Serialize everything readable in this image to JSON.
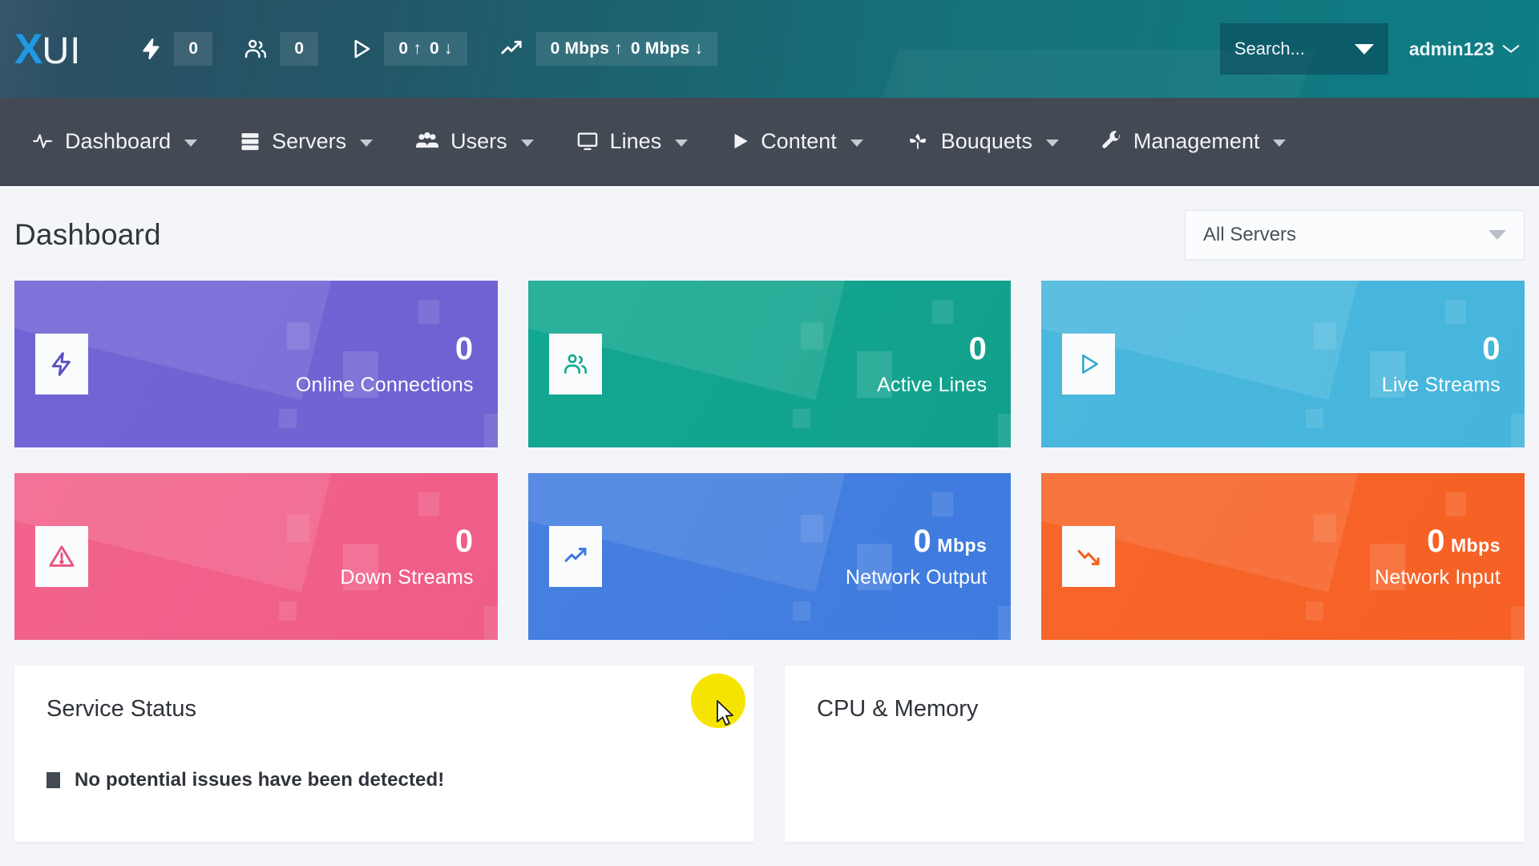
{
  "topbar": {
    "logo": {
      "x": "X",
      "ui": "UI"
    },
    "stats": [
      {
        "icon": "bolt-icon",
        "name": "connections",
        "parts": [
          "0"
        ]
      },
      {
        "icon": "users-icon",
        "name": "users",
        "parts": [
          "0"
        ]
      },
      {
        "icon": "play-icon",
        "name": "streams",
        "parts": [
          "0 ↑",
          "0 ↓"
        ]
      },
      {
        "icon": "trending-up-icon",
        "name": "network",
        "parts": [
          "0 Mbps ↑",
          "0 Mbps ↓"
        ]
      }
    ],
    "search": {
      "placeholder": "Search...",
      "value": "",
      "caret_icon": "caret-down-icon"
    },
    "user": {
      "label": "admin123",
      "chevron_icon": "chevron-down-icon"
    }
  },
  "nav": {
    "items": [
      {
        "label": "Dashboard",
        "icon": "pulse-icon"
      },
      {
        "label": "Servers",
        "icon": "server-icon"
      },
      {
        "label": "Users",
        "icon": "users-group-icon"
      },
      {
        "label": "Lines",
        "icon": "monitor-icon"
      },
      {
        "label": "Content",
        "icon": "play-filled-icon"
      },
      {
        "label": "Bouquets",
        "icon": "leaf-icon"
      },
      {
        "label": "Management",
        "icon": "wrench-icon"
      }
    ]
  },
  "page": {
    "title": "Dashboard",
    "server_filter": {
      "value": "All Servers",
      "caret_icon": "caret-down-icon"
    }
  },
  "cards": [
    {
      "name": "online-connections",
      "icon": "bolt-icon",
      "value": "0",
      "unit": "",
      "label": "Online Connections",
      "color1": "#7264d6",
      "color2": "#6f62d2"
    },
    {
      "name": "active-lines",
      "icon": "users-icon",
      "value": "0",
      "unit": "",
      "label": "Active Lines",
      "color1": "#13a891",
      "color2": "#11a08c"
    },
    {
      "name": "live-streams",
      "icon": "play-icon",
      "value": "0",
      "unit": "",
      "label": "Live Streams",
      "color1": "#4ab8dd",
      "color2": "#45b5dc"
    },
    {
      "name": "down-streams",
      "icon": "warning-icon",
      "value": "0",
      "unit": "",
      "label": "Down Streams",
      "color1": "#f2638c",
      "color2": "#ef5d86"
    },
    {
      "name": "network-output",
      "icon": "trending-up-icon",
      "value": "0",
      "unit": "Mbps",
      "label": "Network Output",
      "color1": "#4680e0",
      "color2": "#3f7bdf"
    },
    {
      "name": "network-input",
      "icon": "trending-down-icon",
      "value": "0",
      "unit": "Mbps",
      "label": "Network Input",
      "color1": "#f8662a",
      "color2": "#f66025"
    }
  ],
  "panels": {
    "service_status": {
      "title": "Service Status",
      "message": "No potential issues have been detected!"
    },
    "cpu_memory": {
      "title": "CPU & Memory"
    }
  }
}
